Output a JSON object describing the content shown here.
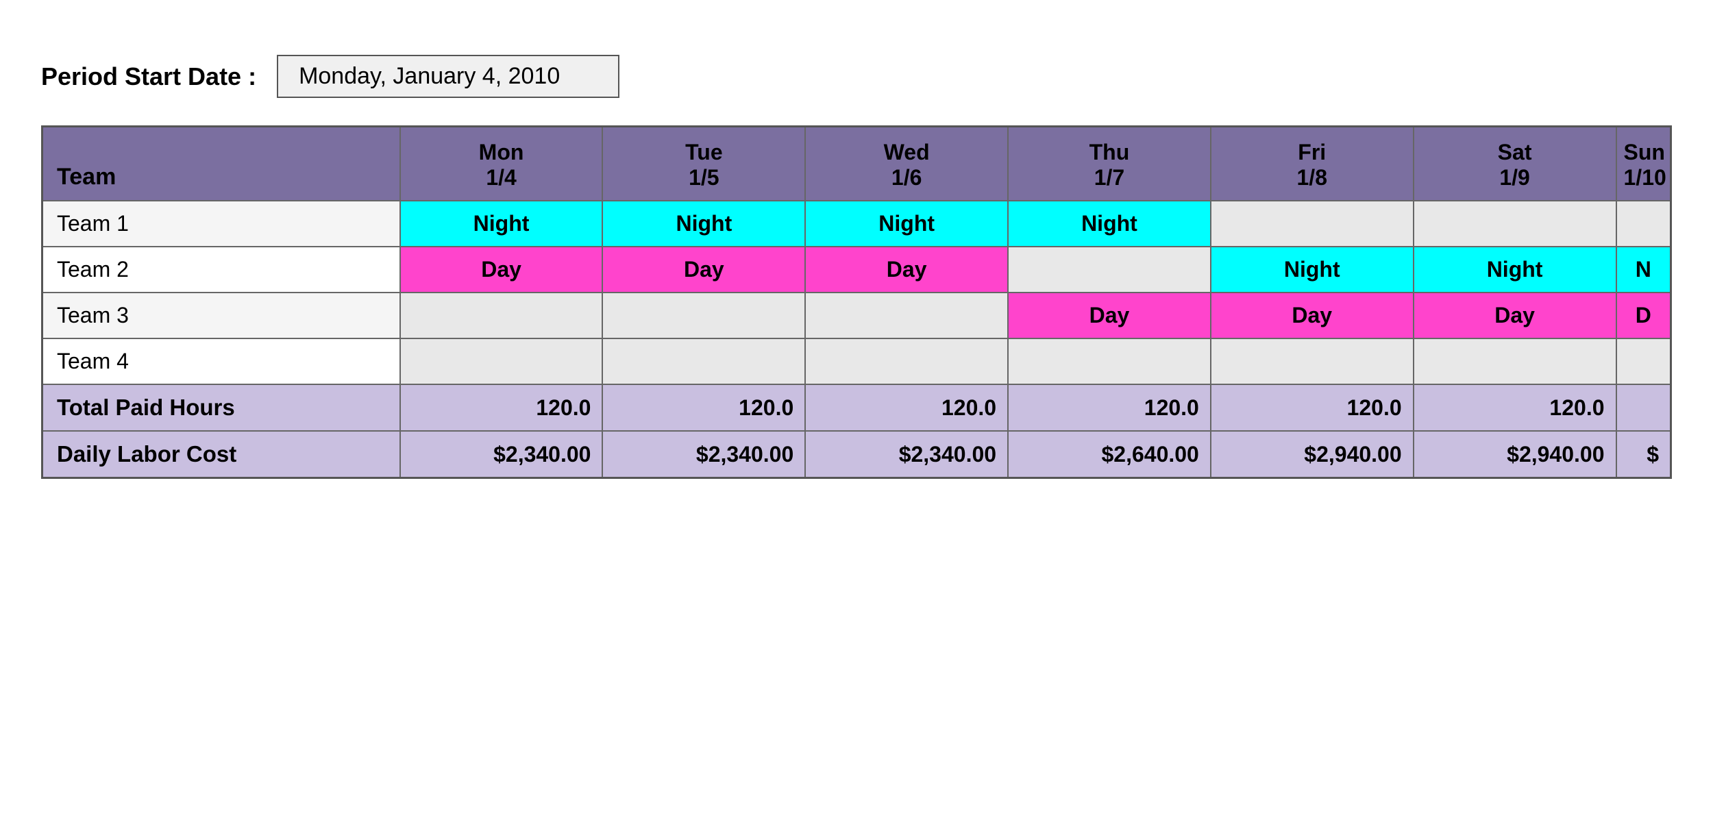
{
  "header": {
    "period_start_label": "Period Start Date :",
    "period_start_value": "Monday, January 4, 2010"
  },
  "table": {
    "columns": [
      {
        "id": "team",
        "label": "Team",
        "sub": ""
      },
      {
        "id": "mon",
        "label": "Mon",
        "sub": "1/4"
      },
      {
        "id": "tue",
        "label": "Tue",
        "sub": "1/5"
      },
      {
        "id": "wed",
        "label": "Wed",
        "sub": "1/6"
      },
      {
        "id": "thu",
        "label": "Thu",
        "sub": "1/7"
      },
      {
        "id": "fri",
        "label": "Fri",
        "sub": "1/8"
      },
      {
        "id": "sat",
        "label": "Sat",
        "sub": "1/9"
      },
      {
        "id": "sun",
        "label": "Sun",
        "sub": "1/10"
      }
    ],
    "teams": [
      {
        "name": "Team 1",
        "shifts": [
          "Night",
          "Night",
          "Night",
          "Night",
          "",
          "",
          ""
        ]
      },
      {
        "name": "Team 2",
        "shifts": [
          "Day",
          "Day",
          "Day",
          "",
          "Night",
          "Night",
          "N"
        ]
      },
      {
        "name": "Team 3",
        "shifts": [
          "",
          "",
          "",
          "Day",
          "Day",
          "Day",
          "D"
        ]
      },
      {
        "name": "Team 4",
        "shifts": [
          "",
          "",
          "",
          "",
          "",
          "",
          ""
        ]
      }
    ],
    "totals": {
      "paid_hours_label": "Total Paid Hours",
      "paid_hours": [
        "120.0",
        "120.0",
        "120.0",
        "120.0",
        "120.0",
        "120.0",
        ""
      ],
      "labor_cost_label": "Daily Labor Cost",
      "labor_cost": [
        "$2,340.00",
        "$2,340.00",
        "$2,340.00",
        "$2,640.00",
        "$2,940.00",
        "$2,940.00",
        "$"
      ]
    }
  }
}
